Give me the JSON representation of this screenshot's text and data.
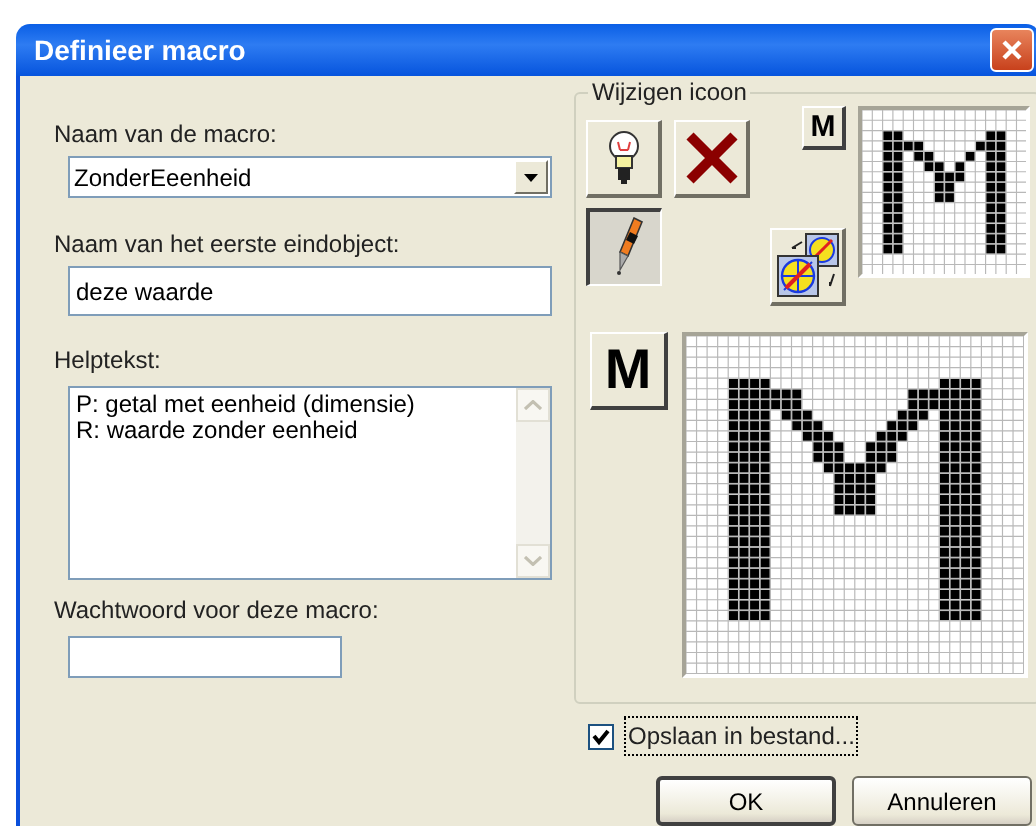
{
  "window": {
    "title": "Definieer macro"
  },
  "fields": [
    {
      "kind": "combo",
      "label": "Naam van de macro:",
      "value": "ZonderEeenheid"
    },
    {
      "kind": "text",
      "label": "Naam van het eerste eindobject:",
      "value": "deze waarde"
    },
    {
      "kind": "memo",
      "label": "Helptekst:",
      "value": "P: getal met eenheid (dimensie)\nR: waarde zonder eenheid"
    },
    {
      "kind": "password",
      "label": "Wachtwoord voor deze macro:"
    }
  ],
  "icon_group": {
    "title": "Wijzigen icoon",
    "preview_label": "M",
    "large_label": "M",
    "tools": [
      {
        "kind": "bulb",
        "pressed": false
      },
      {
        "kind": "delete",
        "pressed": false
      },
      {
        "kind": "pen",
        "pressed": true
      },
      {
        "kind": "copy",
        "pressed": false
      }
    ]
  },
  "save_to_file": {
    "label": "Opslaan in bestand...",
    "checked": true
  },
  "buttons": [
    {
      "label": "OK",
      "default": true
    },
    {
      "label": "Annuleren",
      "default": false
    }
  ]
}
